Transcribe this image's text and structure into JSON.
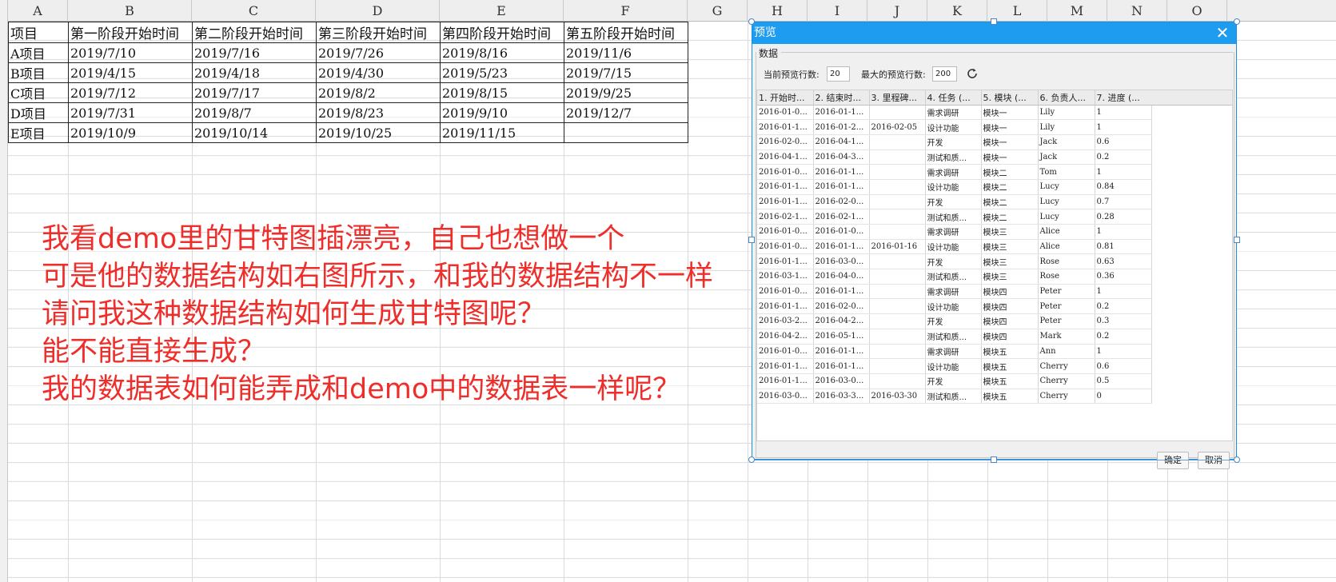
{
  "columns": [
    "A",
    "B",
    "C",
    "D",
    "E",
    "F",
    "G",
    "H",
    "I",
    "J",
    "K",
    "L",
    "M",
    "N",
    "O"
  ],
  "table": {
    "header": [
      "项目",
      "第一阶段开始时间",
      "第二阶段开始时间",
      "第三阶段开始时间",
      "第四阶段开始时间",
      "第五阶段开始时间"
    ],
    "rows": [
      [
        "A项目",
        "2019/7/10",
        "2019/7/16",
        "2019/7/26",
        "2019/8/16",
        "2019/11/6"
      ],
      [
        "B项目",
        "2019/4/15",
        "2019/4/18",
        "2019/4/30",
        "2019/5/23",
        "2019/7/15"
      ],
      [
        "C项目",
        "2019/7/12",
        "2019/7/17",
        "2019/8/2",
        "2019/8/15",
        "2019/9/25"
      ],
      [
        "D项目",
        "2019/7/31",
        "2019/8/7",
        "2019/8/23",
        "2019/9/10",
        "2019/12/7"
      ],
      [
        "E项目",
        "2019/10/9",
        "2019/10/14",
        "2019/10/25",
        "2019/11/15",
        ""
      ]
    ]
  },
  "question_lines": [
    "我看demo里的甘特图插漂亮，自己也想做一个",
    "可是他的数据结构如右图所示，和我的数据结构不一样",
    "请问我这种数据结构如何生成甘特图呢？",
    "能不能直接生成？",
    "我的数据表如何能弄成和demo中的数据表一样呢？"
  ],
  "dialog": {
    "title": "预览",
    "close": "✕",
    "group": "数据",
    "current_rows_label": "当前预览行数:",
    "current_rows_value": "20",
    "max_rows_label": "最大的预览行数:",
    "max_rows_value": "200",
    "refresh_icon": "refresh-icon",
    "ok": "确定",
    "cancel": "取消",
    "preview_headers": [
      "1. 开始时...",
      "2. 结束时...",
      "3. 里程碑...",
      "4. 任务 (...",
      "5. 模块 (...",
      "6. 负责人...",
      "7. 进度 (..."
    ],
    "preview_rows": [
      [
        "2016-01-0...",
        "2016-01-1...",
        "",
        "需求调研",
        "模块一",
        "Lily",
        "1"
      ],
      [
        "2016-01-1...",
        "2016-01-2...",
        "2016-02-05",
        "设计功能",
        "模块一",
        "Lily",
        "1"
      ],
      [
        "2016-02-0...",
        "2016-04-1...",
        "",
        "开发",
        "模块一",
        "Jack",
        "0.6"
      ],
      [
        "2016-04-1...",
        "2016-04-3...",
        "",
        "测试和质...",
        "模块一",
        "Jack",
        "0.2"
      ],
      [
        "2016-01-0...",
        "2016-01-1...",
        "",
        "需求调研",
        "模块二",
        "Tom",
        "1"
      ],
      [
        "2016-01-1...",
        "2016-01-1...",
        "",
        "设计功能",
        "模块二",
        "Lucy",
        "0.84"
      ],
      [
        "2016-01-1...",
        "2016-02-0...",
        "",
        "开发",
        "模块二",
        "Lucy",
        "0.7"
      ],
      [
        "2016-02-1...",
        "2016-02-1...",
        "",
        "测试和质...",
        "模块二",
        "Lucy",
        "0.28"
      ],
      [
        "2016-01-0...",
        "2016-01-0...",
        "",
        "需求调研",
        "模块三",
        "Alice",
        "1"
      ],
      [
        "2016-01-0...",
        "2016-01-1...",
        "2016-01-16",
        "设计功能",
        "模块三",
        "Alice",
        "0.81"
      ],
      [
        "2016-01-1...",
        "2016-03-0...",
        "",
        "开发",
        "模块三",
        "Rose",
        "0.63"
      ],
      [
        "2016-03-1...",
        "2016-04-0...",
        "",
        "测试和质...",
        "模块三",
        "Rose",
        "0.36"
      ],
      [
        "2016-01-0...",
        "2016-01-1...",
        "",
        "需求调研",
        "模块四",
        "Peter",
        "1"
      ],
      [
        "2016-01-1...",
        "2016-02-0...",
        "",
        "设计功能",
        "模块四",
        "Peter",
        "0.2"
      ],
      [
        "2016-03-2...",
        "2016-04-2...",
        "",
        "开发",
        "模块四",
        "Peter",
        "0.3"
      ],
      [
        "2016-04-2...",
        "2016-05-1...",
        "",
        "测试和质...",
        "模块四",
        "Mark",
        "0.2"
      ],
      [
        "2016-01-0...",
        "2016-01-1...",
        "",
        "需求调研",
        "模块五",
        "Ann",
        "1"
      ],
      [
        "2016-01-1...",
        "2016-01-1...",
        "",
        "设计功能",
        "模块五",
        "Cherry",
        "0.6"
      ],
      [
        "2016-01-1...",
        "2016-03-0...",
        "",
        "开发",
        "模块五",
        "Cherry",
        "0.5"
      ],
      [
        "2016-03-0...",
        "2016-03-3...",
        "2016-03-30",
        "测试和质...",
        "模块五",
        "Cherry",
        "0"
      ]
    ]
  },
  "colors": {
    "question_text": "#ee2e2a",
    "dialog_title_bar": "#1e9cf0"
  }
}
